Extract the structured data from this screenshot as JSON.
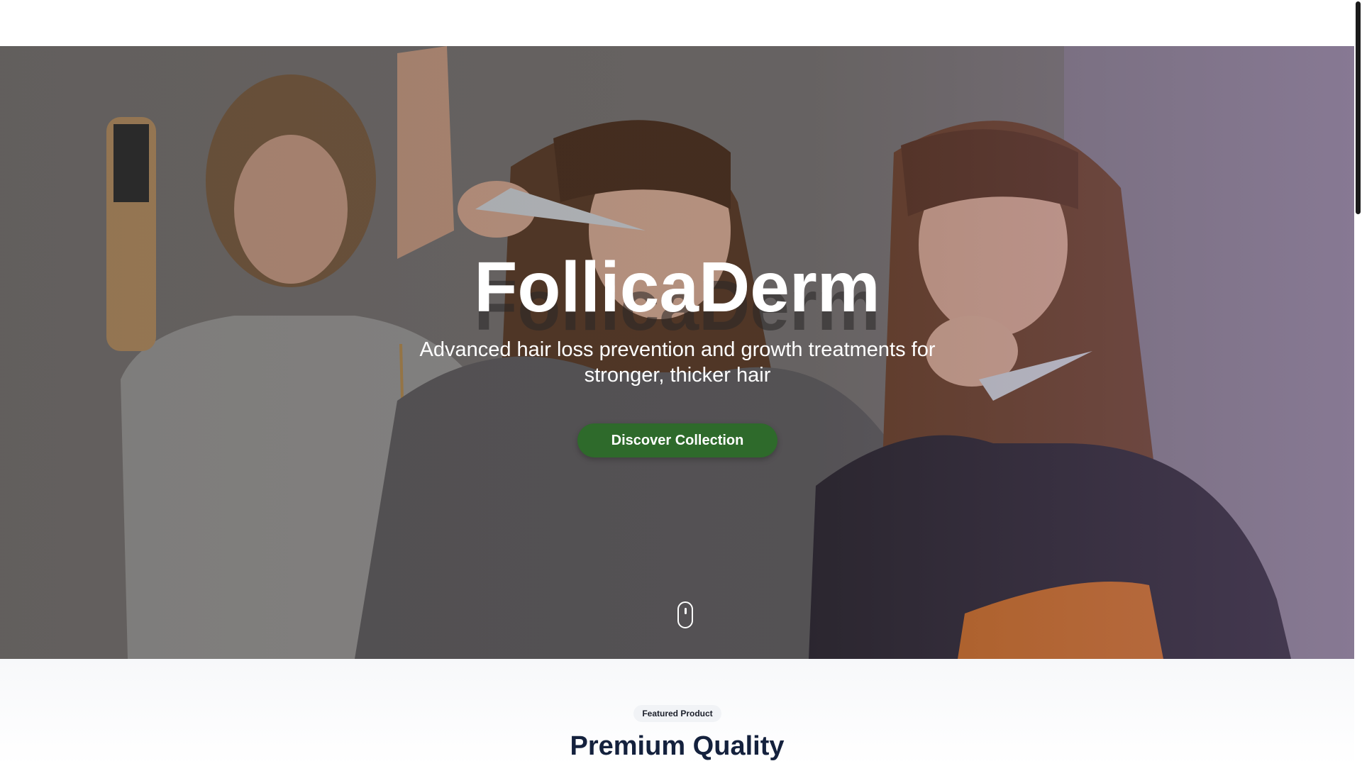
{
  "hero": {
    "title": "FollicaDerm",
    "subtitle": "Advanced hair loss prevention and growth treatments for stronger, thicker hair",
    "cta_label": "Discover Collection",
    "cta_color": "#2e6a2b",
    "scroll_icon": "mouse-scroll-icon",
    "background_image": "three-hair-stylists-photo"
  },
  "featured": {
    "badge": "Featured Product",
    "title": "Premium Quality"
  },
  "colors": {
    "title_text": "#14213d",
    "hero_text": "#ffffff"
  }
}
